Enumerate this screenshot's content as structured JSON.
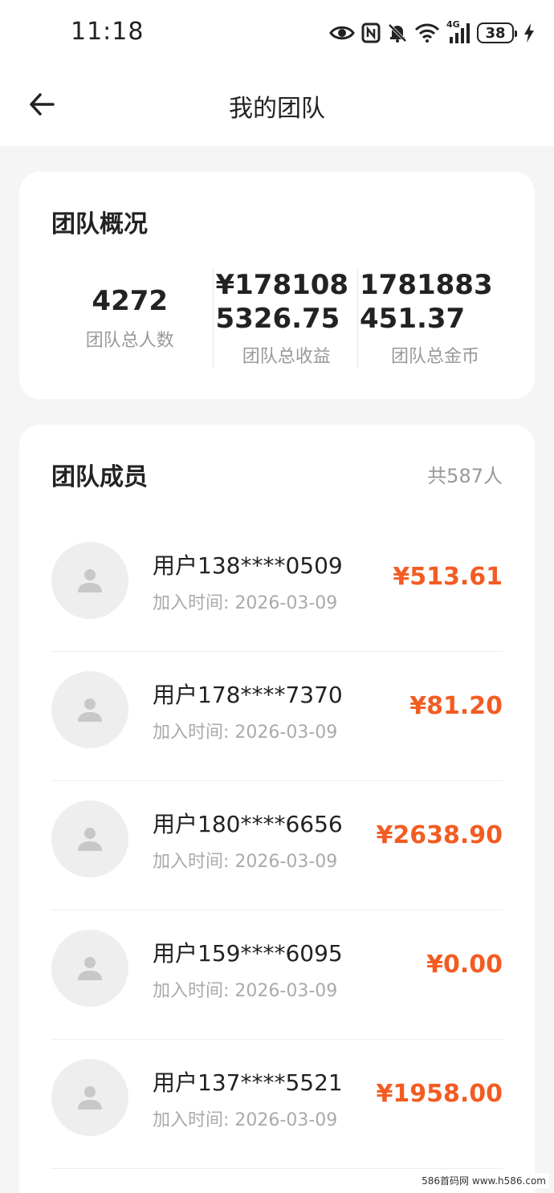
{
  "status_bar": {
    "time": "11:18",
    "network": "4G",
    "battery": "38",
    "icons": [
      "eye-icon",
      "nfc-icon",
      "bell-off-icon",
      "wifi-icon",
      "signal-icon",
      "battery-icon",
      "charging-icon"
    ]
  },
  "nav": {
    "title": "我的团队",
    "back_icon": "arrow-left-icon"
  },
  "overview": {
    "title": "团队概况",
    "stats": [
      {
        "value": "4272",
        "label": "团队总人数"
      },
      {
        "value": "¥1781085326.75",
        "label": "团队总收益"
      },
      {
        "value": "1781883451.37",
        "label": "团队总金币"
      }
    ]
  },
  "members": {
    "title": "团队成员",
    "count": "共587人",
    "items": [
      {
        "name": "用户138****0509",
        "join": "加入时间: 2026-03-09",
        "amount": "¥513.61"
      },
      {
        "name": "用户178****7370",
        "join": "加入时间: 2026-03-09",
        "amount": "¥81.20"
      },
      {
        "name": "用户180****6656",
        "join": "加入时间: 2026-03-09",
        "amount": "¥2638.90"
      },
      {
        "name": "用户159****6095",
        "join": "加入时间: 2026-03-09",
        "amount": "¥0.00"
      },
      {
        "name": "用户137****5521",
        "join": "加入时间: 2026-03-09",
        "amount": "¥1958.00"
      }
    ]
  },
  "watermark": "586首码网 www.h586.com",
  "colors": {
    "accent": "#f25c22",
    "background": "#f5f5f5",
    "card": "#ffffff",
    "text_primary": "#222222",
    "text_secondary": "#999999",
    "avatar_bg": "#eeeeee"
  }
}
